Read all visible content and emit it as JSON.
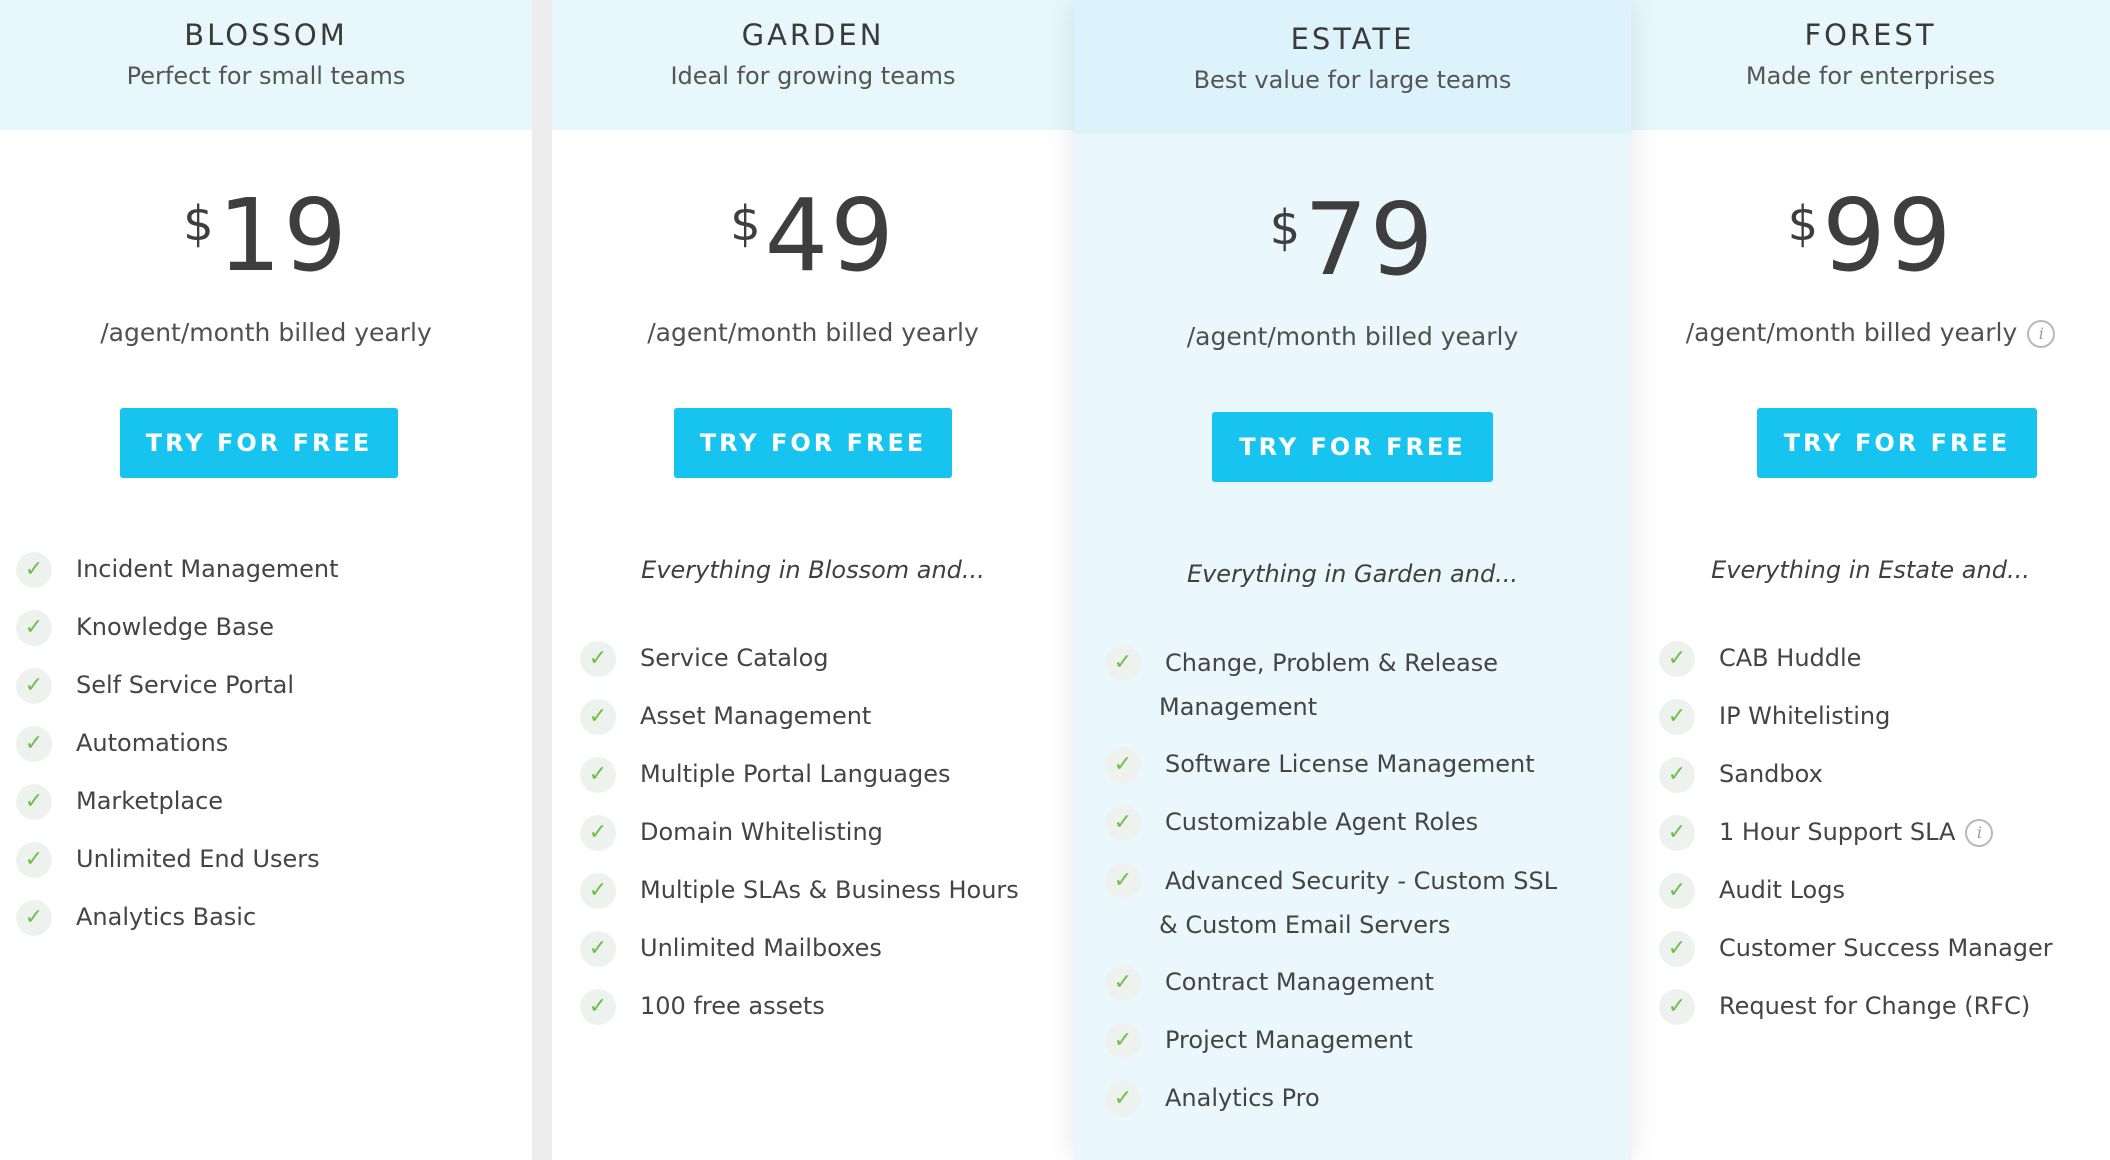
{
  "colors": {
    "header_bg": "#e8f7fc",
    "featured_bg": "#eaf8fd",
    "cta_bg": "#17c4f0",
    "check_color": "#6cc04a",
    "page_bg": "#ededed"
  },
  "plans": [
    {
      "name": "BLOSSOM",
      "tagline": "Perfect for small teams",
      "currency": "$",
      "price": "19",
      "billing": "/agent/month billed yearly",
      "cta": "TRY FOR FREE",
      "intro": "",
      "features": [
        "Incident Management",
        "Knowledge Base",
        "Self Service Portal",
        "Automations",
        "Marketplace",
        "Unlimited End Users",
        "Analytics Basic"
      ]
    },
    {
      "name": "GARDEN",
      "tagline": "Ideal for growing teams",
      "currency": "$",
      "price": "49",
      "billing": "/agent/month billed yearly",
      "cta": "TRY FOR FREE",
      "intro": "Everything in Blossom and...",
      "features": [
        "Service Catalog",
        "Asset Management",
        "Multiple Portal Languages",
        "Domain Whitelisting",
        "Multiple SLAs & Business Hours",
        "Unlimited Mailboxes",
        "100 free assets"
      ]
    },
    {
      "name": "ESTATE",
      "tagline": "Best value for large teams",
      "currency": "$",
      "price": "79",
      "billing": "/agent/month billed yearly",
      "cta": "TRY FOR FREE",
      "intro": "Everything in Garden and...",
      "features": [
        "Change, Problem & Release Management",
        "Software License Management",
        "Customizable Agent Roles",
        "Advanced Security - Custom SSL & Custom Email Servers",
        "Contract Management",
        "Project Management",
        "Analytics Pro"
      ]
    },
    {
      "name": "FOREST",
      "tagline": "Made for enterprises",
      "currency": "$",
      "price": "99",
      "billing": "/agent/month billed yearly",
      "cta": "TRY FOR FREE",
      "intro": "Everything in Estate and...",
      "features": [
        "CAB Huddle",
        "IP Whitelisting",
        "Sandbox",
        "1 Hour Support SLA",
        "Audit Logs",
        "Customer Success Manager",
        "Request for Change (RFC)"
      ]
    }
  ],
  "icons": {
    "check": "check-icon",
    "info": "info-icon",
    "check_glyph": "✓",
    "info_glyph": "i"
  }
}
